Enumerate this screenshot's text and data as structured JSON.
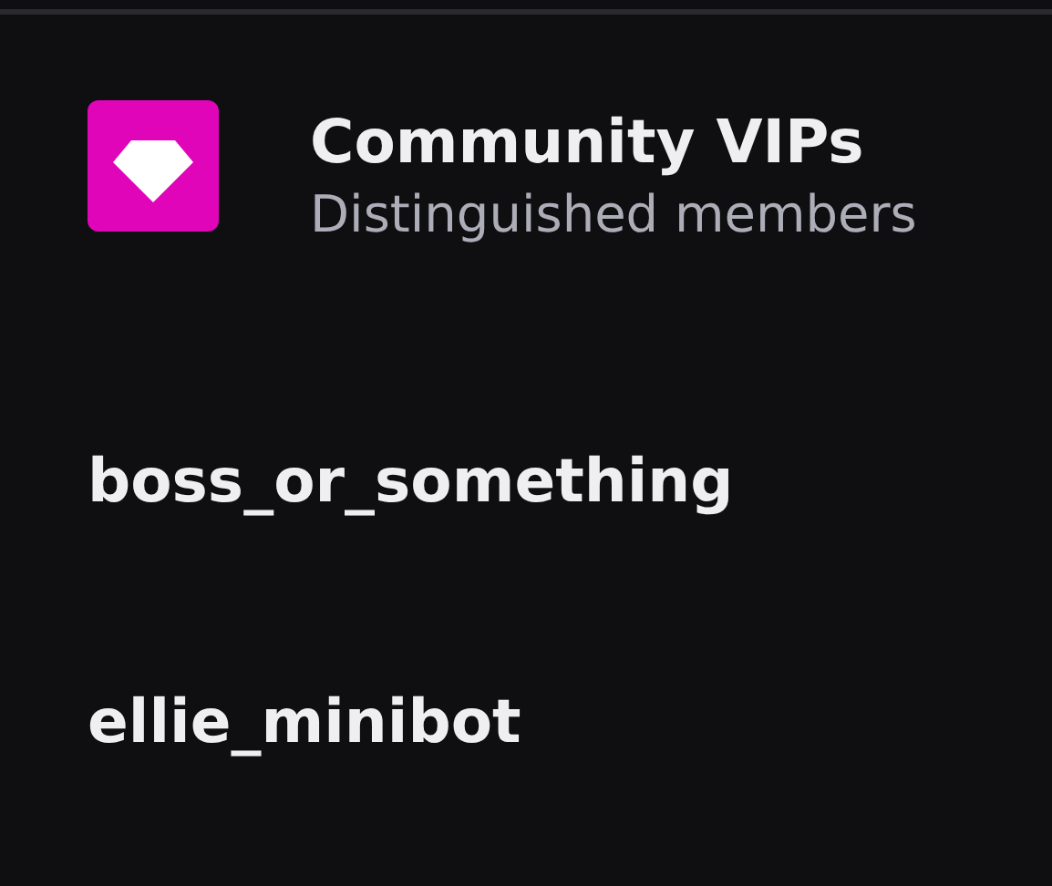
{
  "header": {
    "title": "Community VIPs",
    "subtitle": "Distinguished members"
  },
  "members": [
    {
      "name": "boss_or_something"
    },
    {
      "name": "ellie_minibot"
    }
  ]
}
